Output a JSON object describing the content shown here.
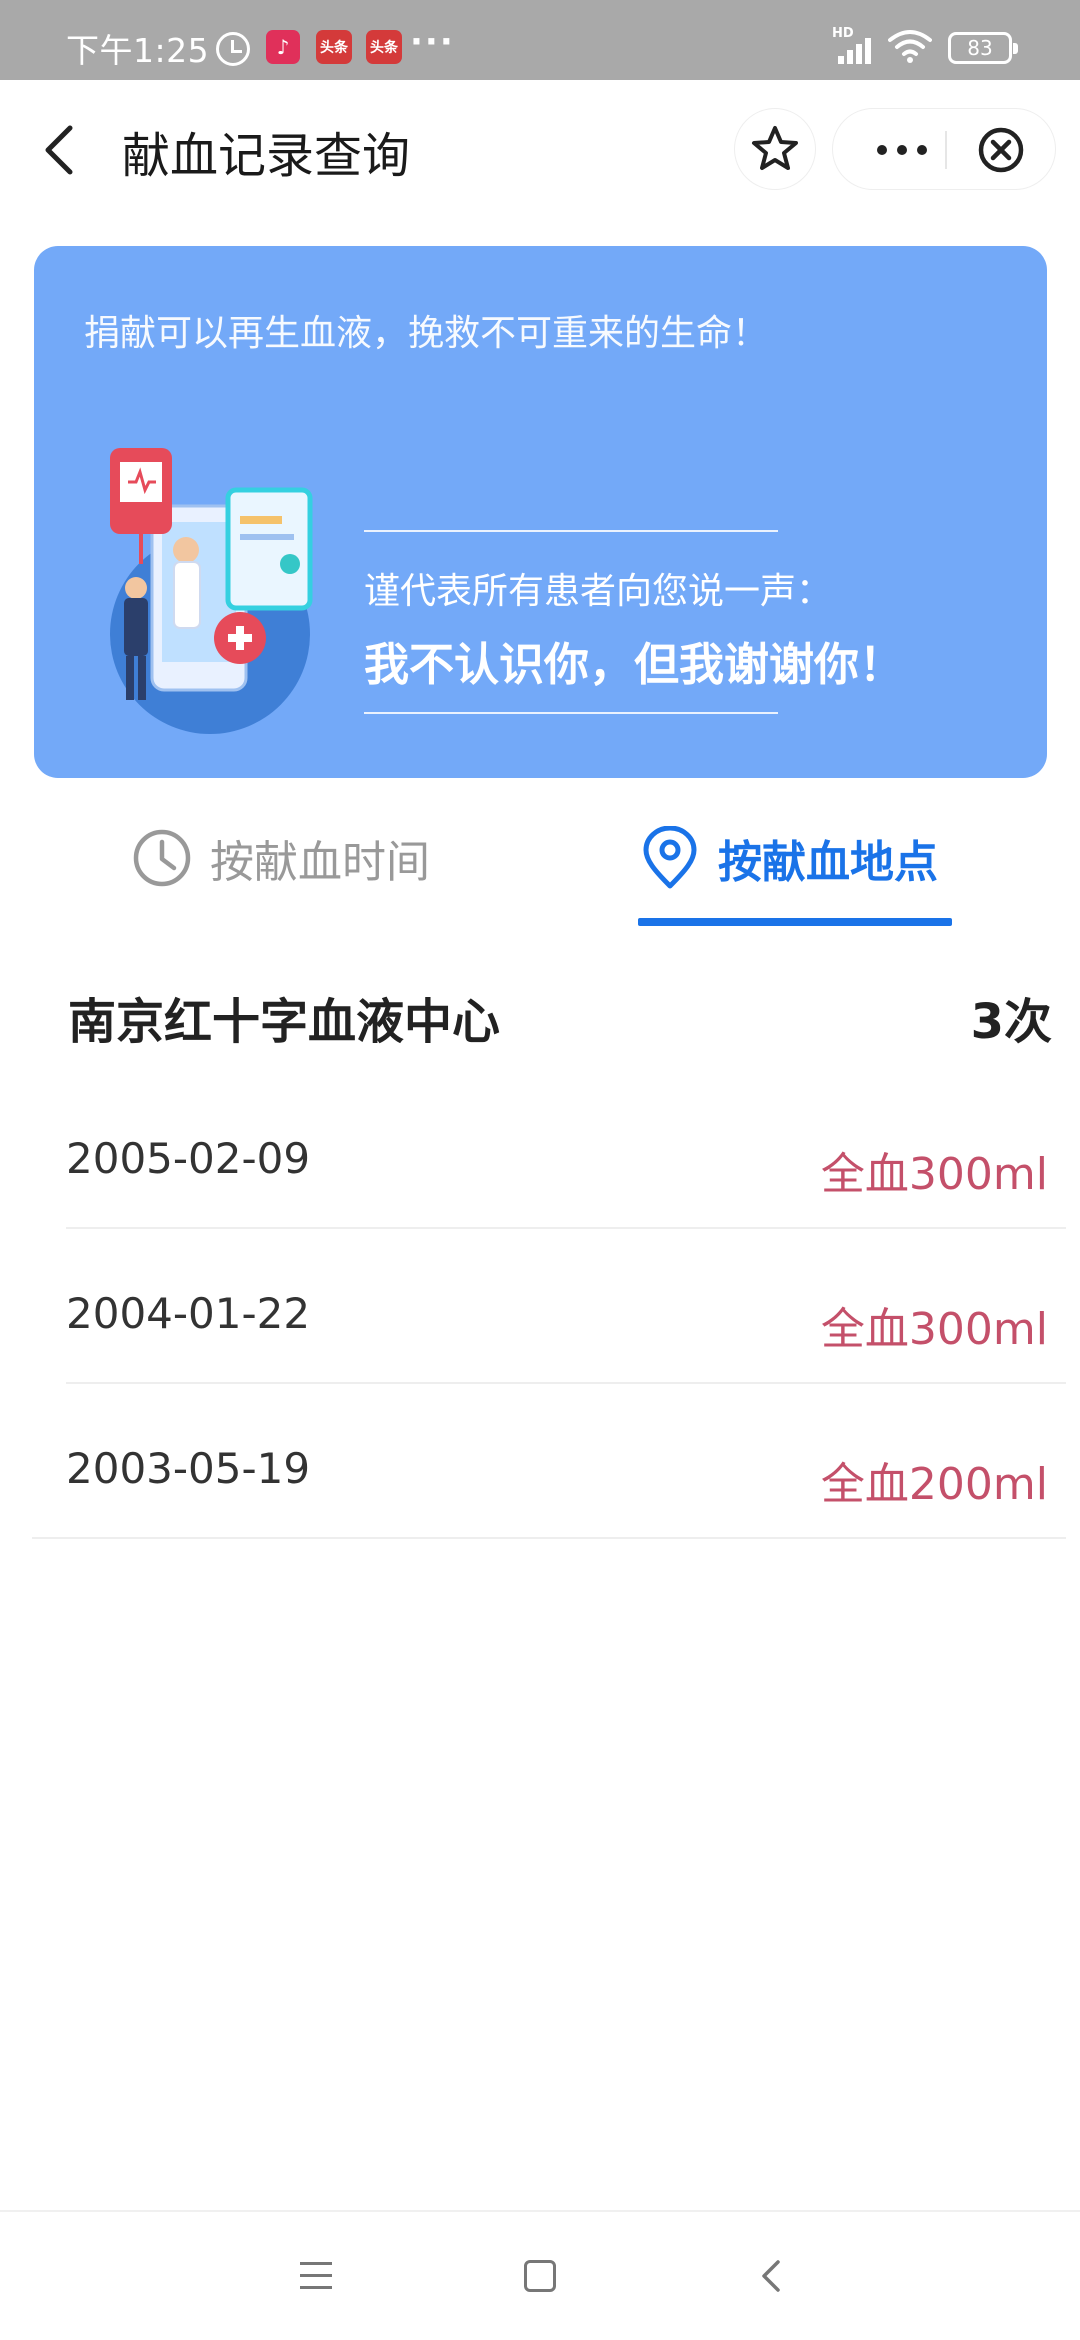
{
  "status_bar": {
    "time": "下午1:25",
    "badges": [
      "头条",
      "头条"
    ],
    "dots": "···",
    "network": "HD",
    "battery": "83"
  },
  "header": {
    "title": "献血记录查询"
  },
  "banner": {
    "slogan": "捐献可以再生血液，挽救不可重来的生命！",
    "sub_text": "谨代表所有患者向您说一声：",
    "thanks_text": "我不认识你，但我谢谢你！",
    "background_color": "#73a9f8"
  },
  "tabs": [
    {
      "label": "按献血时间",
      "icon": "clock-icon",
      "active": false
    },
    {
      "label": "按献血地点",
      "icon": "location-pin-icon",
      "active": true
    }
  ],
  "location": {
    "name": "南京红十字血液中心",
    "count": "3次"
  },
  "records": [
    {
      "date": "2005-02-09",
      "amount": "全血300ml"
    },
    {
      "date": "2004-01-22",
      "amount": "全血300ml"
    },
    {
      "date": "2003-05-19",
      "amount": "全血200ml"
    }
  ],
  "colors": {
    "accent": "#1a73e8",
    "amount": "#c4506a"
  }
}
